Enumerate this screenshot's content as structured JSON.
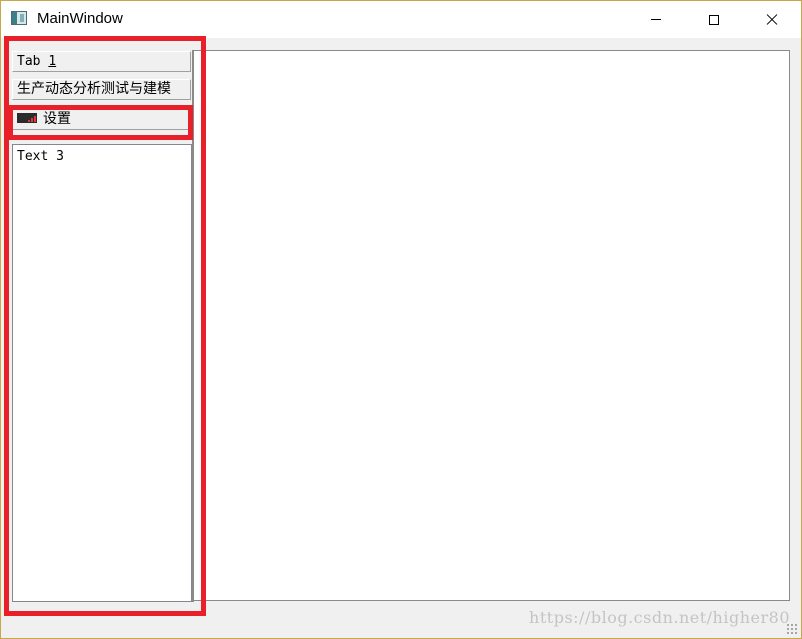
{
  "window": {
    "title": "MainWindow",
    "icon": "qt-window-icon",
    "controls": [
      "minimize-icon",
      "maximize-icon",
      "close-icon"
    ]
  },
  "toolbox": {
    "tabs": [
      {
        "label_prefix": "Tab ",
        "label_mnemonic": "1"
      },
      {
        "label": "生产动态分析测试与建模"
      },
      {
        "label": "设置",
        "icon": "settings-bar-icon"
      }
    ],
    "current_page_text": "Text 3"
  },
  "annotations": {
    "color": "#e8202a"
  },
  "watermark": "https://blog.csdn.net/higher80"
}
